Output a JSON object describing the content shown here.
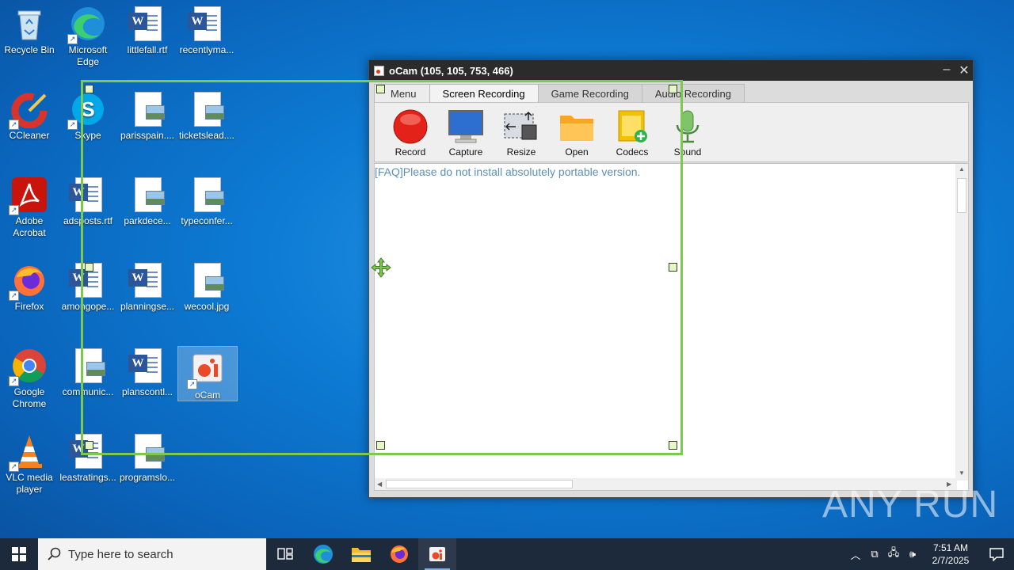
{
  "desktop": {
    "icons": [
      {
        "label": "Recycle Bin"
      },
      {
        "label": "Microsoft Edge"
      },
      {
        "label": "littlefall.rtf"
      },
      {
        "label": "recentlyma..."
      },
      {
        "label": "CCleaner"
      },
      {
        "label": "Skype"
      },
      {
        "label": "parisspain...."
      },
      {
        "label": "ticketslead...."
      },
      {
        "label": "Adobe Acrobat"
      },
      {
        "label": "adsposts.rtf"
      },
      {
        "label": "parkdece..."
      },
      {
        "label": "typeconfer..."
      },
      {
        "label": "Firefox"
      },
      {
        "label": "amongope..."
      },
      {
        "label": "planningse..."
      },
      {
        "label": "wecool.jpg"
      },
      {
        "label": "Google Chrome"
      },
      {
        "label": "communic..."
      },
      {
        "label": "planscontl..."
      },
      {
        "label": "oCam"
      },
      {
        "label": "VLC media player"
      },
      {
        "label": "leastratings..."
      },
      {
        "label": "programslo..."
      }
    ]
  },
  "ocam": {
    "title": "oCam (105, 105, 753, 466)",
    "window_controls": {
      "minimize": "–",
      "close": "✕"
    },
    "tabs": [
      "Menu",
      "Screen Recording",
      "Game Recording",
      "Audio Recording"
    ],
    "active_tab": "Screen Recording",
    "tools": [
      "Record",
      "Capture",
      "Resize",
      "Open",
      "Codecs",
      "Sound"
    ],
    "faq_text": "[FAQ]Please do not install absolutely portable version.",
    "region_color": "#7dc950"
  },
  "taskbar": {
    "search_placeholder": "Type here to search",
    "time": "7:51 AM",
    "date": "2/7/2025",
    "color": "#1d2a3c"
  },
  "watermark": "ANY RUN"
}
